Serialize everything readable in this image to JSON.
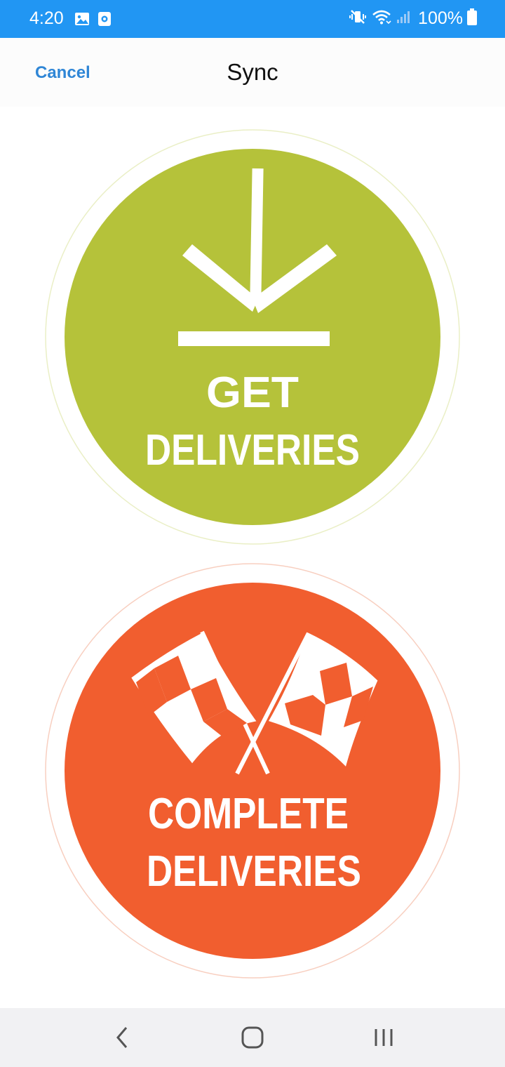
{
  "status_bar": {
    "time": "4:20",
    "battery": "100%",
    "color": "#2196f3"
  },
  "header": {
    "cancel_label": "Cancel",
    "title": "Sync",
    "link_color": "#2f86d6"
  },
  "actions": {
    "get": {
      "line1": "GET",
      "line2": "DELIVERIES",
      "color": "#b5c23a",
      "icon": "download-icon"
    },
    "complete": {
      "line1": "COMPLETE",
      "line2": "DELIVERIES",
      "color": "#f15e2f",
      "icon": "checkered-flags-icon"
    }
  },
  "system_nav": {
    "back": "back-icon",
    "home": "home-icon",
    "recents": "recents-icon"
  }
}
